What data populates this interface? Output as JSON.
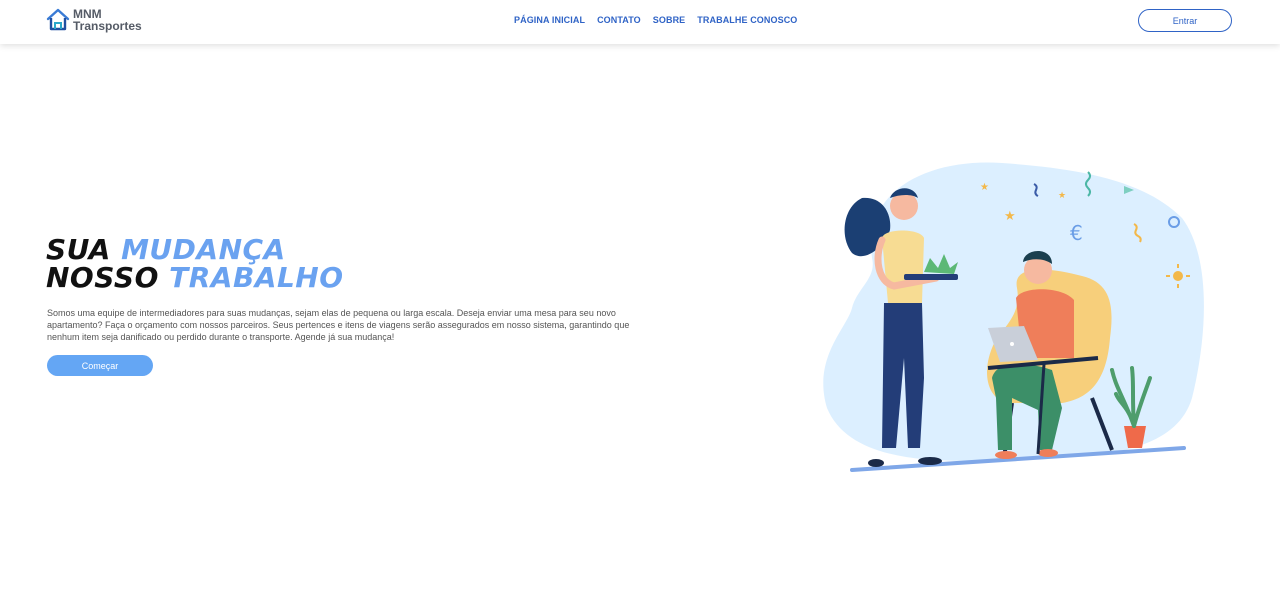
{
  "brand": {
    "line1": "MNM",
    "line2": "Transportes"
  },
  "nav": {
    "items": [
      "PÁGINA INICIAL",
      "CONTATO",
      "SOBRE",
      "TRABALHE CONOSCO"
    ],
    "login_label": "Entrar"
  },
  "hero": {
    "line1_plain": "SUA ",
    "line1_accent": "MUDANÇA",
    "line2_plain": "NOSSO ",
    "line2_accent": "TRABALHO",
    "description": "Somos uma equipe de intermediadores para suas mudanças, sejam elas de pequena ou larga escala. Deseja enviar uma mesa para seu novo apartamento? Faça o orçamento com nossos parceiros. Seus pertences e itens de viagens serão assegurados em nosso sistema, garantindo que nenhum item seja danificado ou perdido durante o transporte. Agende já sua mudança!",
    "cta_label": "Começar"
  },
  "colors": {
    "primary": "#2f63c6",
    "accent": "#6aa2f0",
    "button": "#64a6f4",
    "illustration_bg": "#dcefff"
  },
  "icons": {
    "logo": "house-icon",
    "illustration": "people-working-illustration"
  }
}
